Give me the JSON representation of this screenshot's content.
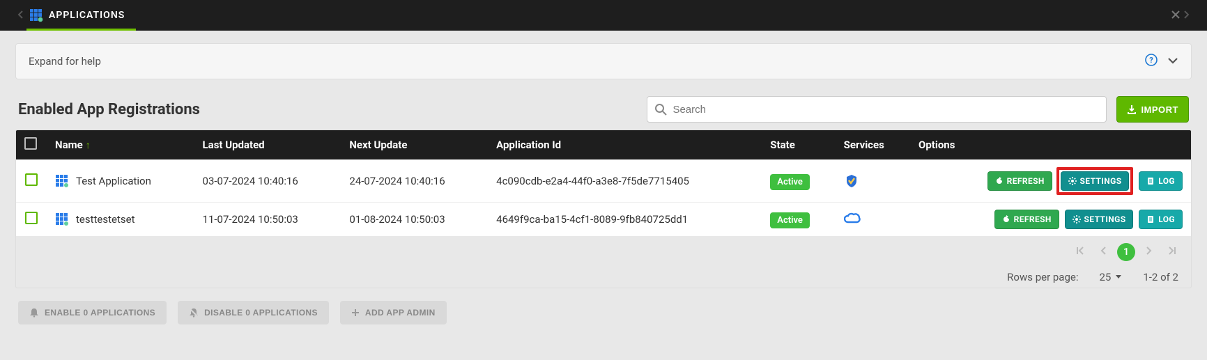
{
  "tab": {
    "title": "APPLICATIONS"
  },
  "help": {
    "text": "Expand for help"
  },
  "section": {
    "title": "Enabled App Registrations"
  },
  "search": {
    "placeholder": "Search"
  },
  "import": {
    "label": "IMPORT"
  },
  "columns": {
    "name": "Name",
    "last_updated": "Last Updated",
    "next_update": "Next Update",
    "app_id": "Application Id",
    "state": "State",
    "services": "Services",
    "options": "Options"
  },
  "rows": [
    {
      "name": "Test Application",
      "last_updated": "03-07-2024 10:40:16",
      "next_update": "24-07-2024 10:40:16",
      "app_id": "4c090cdb-e2a4-44f0-a3e8-7f5de7715405",
      "state": "Active",
      "service_icon": "defender-icon",
      "highlight_settings": true
    },
    {
      "name": "testtestetset",
      "last_updated": "11-07-2024 10:50:03",
      "next_update": "01-08-2024 10:50:03",
      "app_id": "4649f9ca-ba15-4cf1-8089-9fb840725dd1",
      "state": "Active",
      "service_icon": "cloud-icon",
      "highlight_settings": false
    }
  ],
  "row_buttons": {
    "refresh": "REFRESH",
    "settings": "SETTINGS",
    "log": "LOG"
  },
  "pagination": {
    "current": "1",
    "rows_per_page_label": "Rows per page:",
    "rows_per_page_value": "25",
    "range_text": "1-2 of 2"
  },
  "footer": {
    "enable": "ENABLE 0 APPLICATIONS",
    "disable": "DISABLE 0 APPLICATIONS",
    "add_admin": "ADD APP ADMIN"
  }
}
